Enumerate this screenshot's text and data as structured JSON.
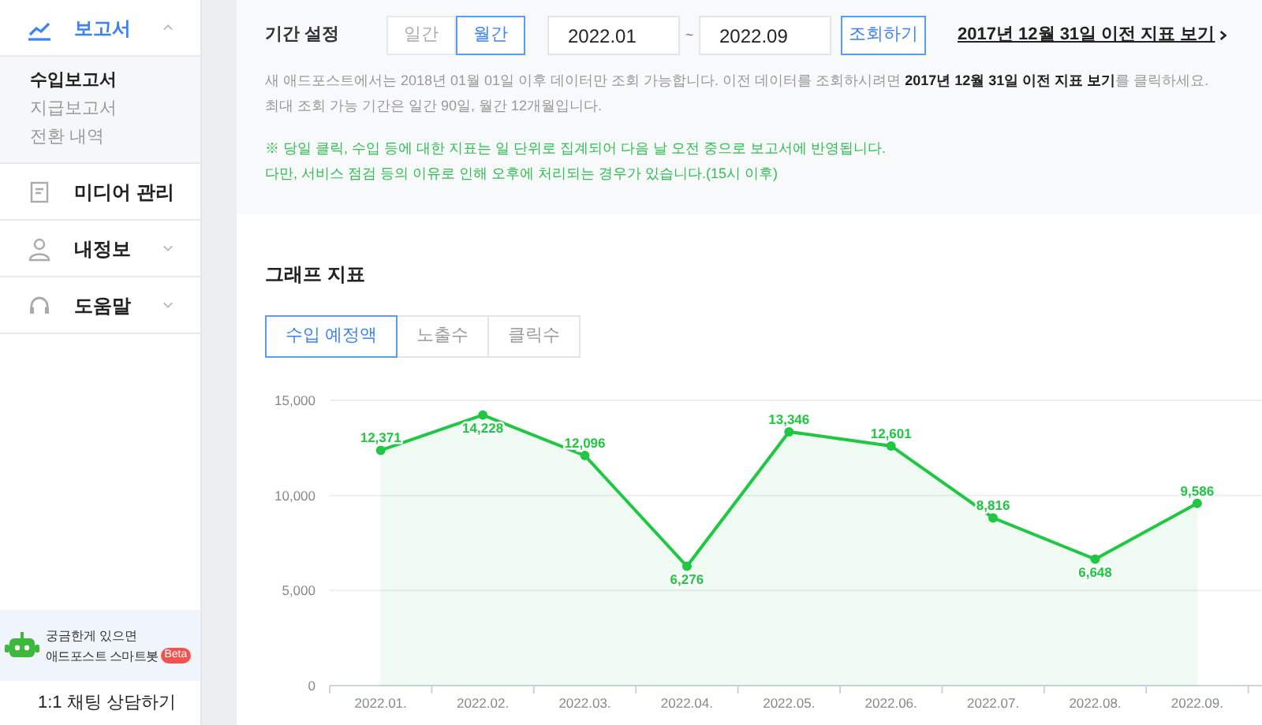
{
  "sidebar": {
    "menus": [
      {
        "label": "보고서",
        "expanded": true,
        "children": [
          {
            "label": "수입보고서",
            "selected": true
          },
          {
            "label": "지급보고서",
            "selected": false
          },
          {
            "label": "전환 내역",
            "selected": false
          }
        ]
      },
      {
        "label": "미디어 관리",
        "expanded": false
      },
      {
        "label": "내정보",
        "expanded": false
      },
      {
        "label": "도움말",
        "expanded": false
      }
    ],
    "chatbot": {
      "line_1": "궁금한게 있으면",
      "line_2": "애드포스트 스마트봇",
      "badge": "Beta"
    },
    "chat_button": "1:1 채팅 상담하기"
  },
  "period": {
    "label": "기간 설정",
    "options": [
      {
        "label": "일간",
        "selected": false
      },
      {
        "label": "월간",
        "selected": true
      }
    ],
    "start": "2022.01",
    "separator": "~",
    "end": "2022.09",
    "search_button": "조회하기",
    "old_link": "2017년 12월 31일 이전 지표 보기",
    "notes": [
      "새 애드포스트에서는 2018년 01월 01일 이후 데이터만 조회 가능합니다. 이전 데이터를 조회하시려면 **2017년 12월 31일 이전 지표 보기**를 클릭하세요.",
      "최대 조회 가능 기간은 일간 90일, 월간 12개월입니다."
    ],
    "green_notes": [
      "※ 당일 클릭, 수입 등에 대한 지표는 일 단위로 집계되어 다음 날 오전 중으로 보고서에 반영됩니다.",
      "다만, 서비스 점검 등의 이유로 인해 오후에 처리되는 경우가 있습니다.(15시 이후)"
    ]
  },
  "graph": {
    "title": "그래프 지표",
    "tabs": [
      {
        "label": "수입 예정액",
        "selected": true
      },
      {
        "label": "노출수",
        "selected": false
      },
      {
        "label": "클릭수",
        "selected": false
      }
    ],
    "chart_data": {
      "type": "area",
      "categories": [
        "2022.01.",
        "2022.02.",
        "2022.03.",
        "2022.04.",
        "2022.05.",
        "2022.06.",
        "2022.07.",
        "2022.08.",
        "2022.09."
      ],
      "series": [
        {
          "color": "#1fc742",
          "values": [
            12371,
            14228,
            12096,
            6276,
            13346,
            12601,
            8816,
            6648,
            9586
          ]
        }
      ],
      "ylim": [
        0,
        15000
      ],
      "yticks": [
        {
          "value": 0,
          "label": "0"
        },
        {
          "value": 5000,
          "label": "5,000"
        },
        {
          "value": 10000,
          "label": "10,000"
        },
        {
          "value": 15000,
          "label": "15,000"
        }
      ],
      "value_labels": [
        "12,371",
        "14,228",
        "12,096",
        "6,276",
        "13,346",
        "12,601",
        "8,816",
        "6,648",
        "9,586"
      ]
    }
  }
}
